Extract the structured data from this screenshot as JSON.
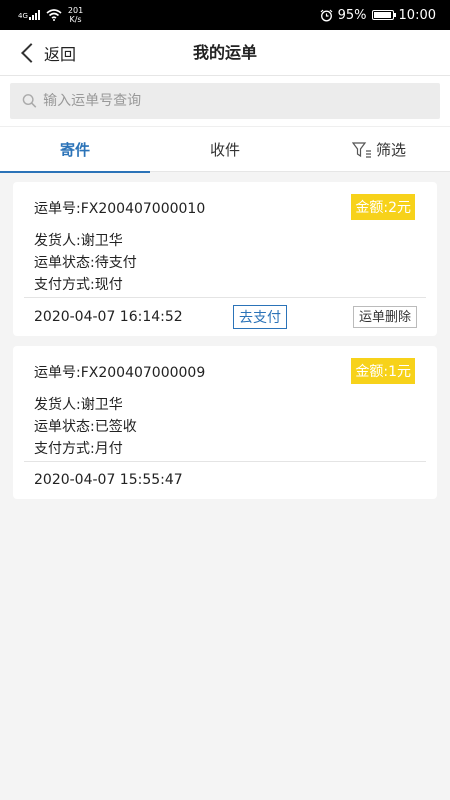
{
  "status_bar": {
    "network": "4G",
    "speed_value": "201",
    "speed_unit": "K/s",
    "battery": "95%",
    "battery_level": 0.95,
    "time": "10:00"
  },
  "header": {
    "back_label": "返回",
    "title": "我的运单"
  },
  "search": {
    "placeholder": "输入运单号查询"
  },
  "tabs": [
    {
      "label": "寄件",
      "active": true
    },
    {
      "label": "收件",
      "active": false
    },
    {
      "label": "筛选",
      "active": false
    }
  ],
  "orders": [
    {
      "order_no": "运单号:FX200407000010",
      "amount": "金额:2元",
      "shipper": "发货人:谢卫华",
      "status": "运单状态:待支付",
      "payment": "支付方式:现付",
      "time": "2020-04-07 16:14:52",
      "pay_label": "去支付",
      "delete_label": "运单删除"
    },
    {
      "order_no": "运单号:FX200407000009",
      "amount": "金额:1元",
      "shipper": "发货人:谢卫华",
      "status": "运单状态:已签收",
      "payment": "支付方式:月付",
      "time": "2020-04-07 15:55:47"
    }
  ],
  "colors": {
    "accent": "#2b73b8",
    "amount_badge": "#f7d21a",
    "background": "#f4f4f4"
  }
}
